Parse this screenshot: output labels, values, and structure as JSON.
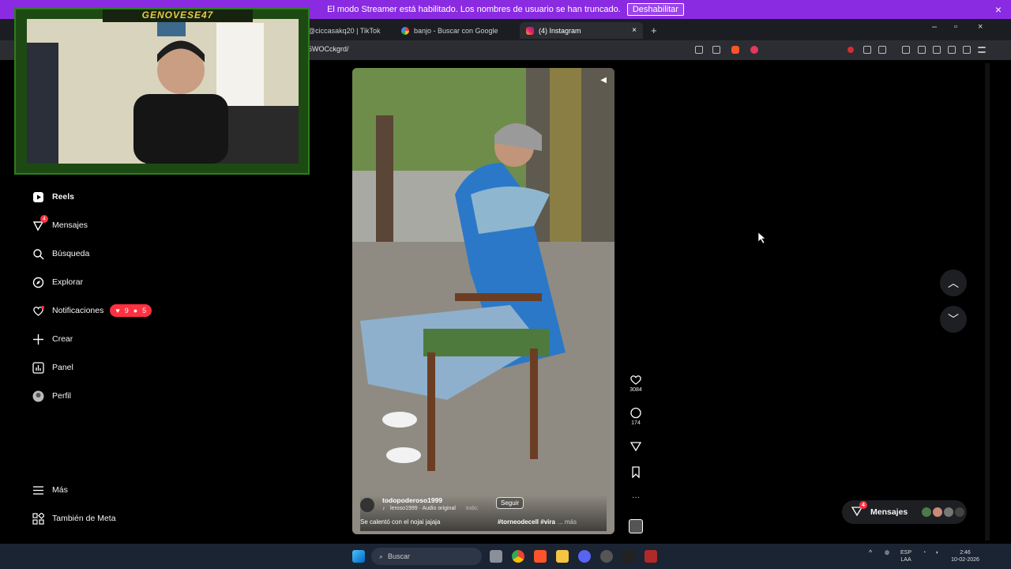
{
  "streamer_bar": {
    "text": "El modo Streamer está habilitado. Los nombres de usuario se han truncado.",
    "button": "Deshabilitar"
  },
  "tabs": [
    {
      "label": "@ciccasakq20 | TikTok"
    },
    {
      "label": "banjo - Buscar con Google"
    },
    {
      "label": "(4) Instagram",
      "close": "×"
    }
  ],
  "new_tab": "+",
  "window_controls": {
    "minimize": "–",
    "maximize": "▫",
    "close": "×"
  },
  "address": {
    "url": "6WOCckgrd/"
  },
  "webcam": {
    "title": "GENOVESE47"
  },
  "sidebar": {
    "items": [
      {
        "label": "Reels",
        "icon": "reels-icon"
      },
      {
        "label": "Mensajes",
        "icon": "messenger-icon",
        "badge": "4"
      },
      {
        "label": "Búsqueda",
        "icon": "search-icon"
      },
      {
        "label": "Explorar",
        "icon": "compass-icon"
      },
      {
        "label": "Notificaciones",
        "icon": "heart-icon",
        "likes": "9",
        "follows": "5"
      },
      {
        "label": "Crear",
        "icon": "plus-icon"
      },
      {
        "label": "Panel",
        "icon": "chart-icon"
      },
      {
        "label": "Perfil",
        "icon": "avatar-icon"
      },
      {
        "label": "Más",
        "icon": "menu-icon"
      },
      {
        "label": "También de Meta",
        "icon": "meta-icon"
      }
    ]
  },
  "reel": {
    "username": "todopoderoso1999",
    "follow": "Seguir",
    "audio": "leroso1999 · Audio original",
    "audio_extra": "todo;",
    "caption": "Se calentó con el nojai jajaja",
    "hashtags": "#torneodecell #vira",
    "more": "... más",
    "likes": "3084",
    "comments": "174"
  },
  "messages_pill": {
    "label": "Mensajes",
    "badge": "4"
  },
  "taskbar": {
    "search": "Buscar",
    "lang": "ESP",
    "layout": "LAA",
    "time": "2:46",
    "date": "10-02-2026",
    "caret": "^"
  }
}
